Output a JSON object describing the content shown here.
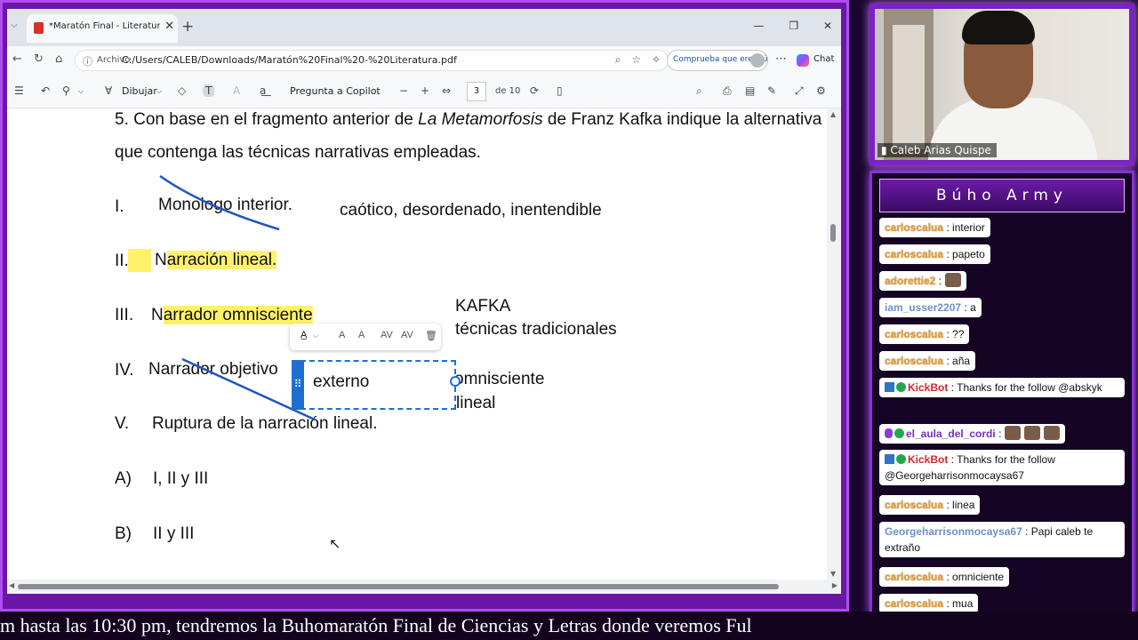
{
  "browser": {
    "tab_title": "*Maratón Final - Literatura.pdf",
    "address_label": "Archivo",
    "url": "C:/Users/CALEB/Downloads/Maratón%20Final%20-%20Literatura.pdf",
    "identity_label": "Comprueba que eres tú",
    "chat_label": "Chat"
  },
  "pdf_toolbar": {
    "draw_label": "Dibujar",
    "ask_copilot_label": "Pregunta a Copilot",
    "current_page": "3",
    "page_of": "de 10"
  },
  "document": {
    "question_line1_pre": "5. Con base en el fragmento anterior de ",
    "question_line1_italic": "La Metamorfosis",
    "question_line1_post": " de Franz Kafka indique la alternativa",
    "question_line2": "que contenga las técnicas narrativas empleadas.",
    "items": [
      {
        "num": "I.",
        "text": "Monologo interior."
      },
      {
        "num": "II.",
        "pre": "N",
        "text": "arración lineal."
      },
      {
        "num": "III.",
        "pre": "N",
        "text": "arrador omnisciente"
      },
      {
        "num": "IV.",
        "text": "Narrador objetivo"
      },
      {
        "num": "V.",
        "text": "Ruptura de la narración lineal."
      }
    ],
    "options": [
      {
        "letter": "A)",
        "text": "I, II y III"
      },
      {
        "letter": "B)",
        "text": "II y III"
      }
    ],
    "notes": {
      "chaotic": "caótico, desordenado, inentendible",
      "kafka": "KAFKA",
      "traditional": "técnicas tradicionales",
      "omniscient": "omnisciente",
      "linear": "lineal"
    },
    "textbox_value": "externo"
  },
  "webcam": {
    "name": "Caleb Arias Quispe"
  },
  "chat": {
    "title": "Búho Army",
    "messages": [
      {
        "user": "carloscalua",
        "text": ": interior"
      },
      {
        "user": "carloscalua",
        "text": ": papeto"
      },
      {
        "user": "adorettie2",
        "text": ":"
      },
      {
        "user": "iam_usser2207",
        "text": ": a"
      },
      {
        "user": "carloscalua",
        "text": ": ??"
      },
      {
        "user": "carloscalua",
        "text": ": aña"
      },
      {
        "user": "KickBot",
        "text": ": Thanks for the follow @abskyk"
      },
      {
        "user": "el_aula_del_cordi",
        "text": ":"
      },
      {
        "user": "KickBot",
        "text": ": Thanks for the follow @Georgeharrisonmocaysa67"
      },
      {
        "user": "carloscalua",
        "text": ": linea"
      },
      {
        "user": "Georgeharrisonmocaysa67",
        "text": ": Papi caleb te extraño"
      },
      {
        "user": "carloscalua",
        "text": ": omniciente"
      },
      {
        "user": "carloscalua",
        "text": ": mua"
      }
    ]
  },
  "ticker": {
    "text": "m hasta las 10:30 pm, tendremos la Buhomaratón Final de Ciencias y Letras donde veremos Ful"
  },
  "colors": {
    "highlight": "#fff26b",
    "ink": "#1f55c0",
    "frame_purple": "#6a17a8",
    "username_gold": "#e8a13a"
  }
}
